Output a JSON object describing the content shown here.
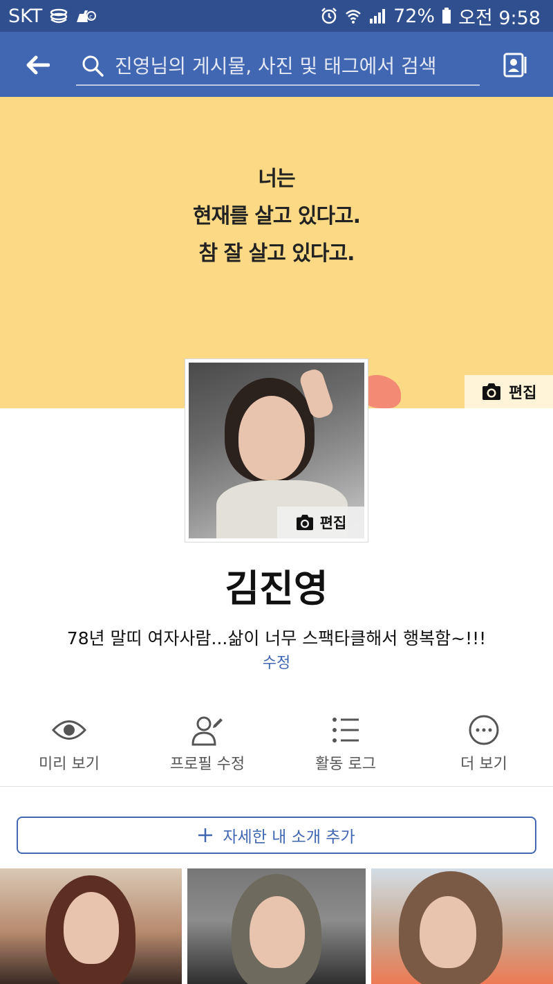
{
  "status_bar": {
    "carrier": "SKT",
    "battery": "72%",
    "time": "오전 9:58"
  },
  "app_bar": {
    "search_placeholder": "진영님의 게시물, 사진 및 태그에서 검색"
  },
  "cover": {
    "quote_lines": [
      "너는",
      "현재를 살고 있다고.",
      "참 잘 살고 있다고."
    ],
    "edit_label": "편집"
  },
  "avatar": {
    "edit_label": "편집"
  },
  "profile": {
    "name": "김진영",
    "bio": "78년 말띠 여자사람...삶이 너무 스팩타클해서 행복함~!!!",
    "edit_bio_label": "수정"
  },
  "actions": [
    {
      "label": "미리 보기",
      "icon": "eye-icon"
    },
    {
      "label": "프로필 수정",
      "icon": "edit-profile-icon"
    },
    {
      "label": "활동 로그",
      "icon": "list-icon"
    },
    {
      "label": "더 보기",
      "icon": "more-icon"
    }
  ],
  "add_intro_label": "자세한 내 소개 추가",
  "colors": {
    "status_bar": "#2f4f8e",
    "app_bar": "#4267b2",
    "cover": "#fbd985",
    "accent": "#4267b2"
  }
}
